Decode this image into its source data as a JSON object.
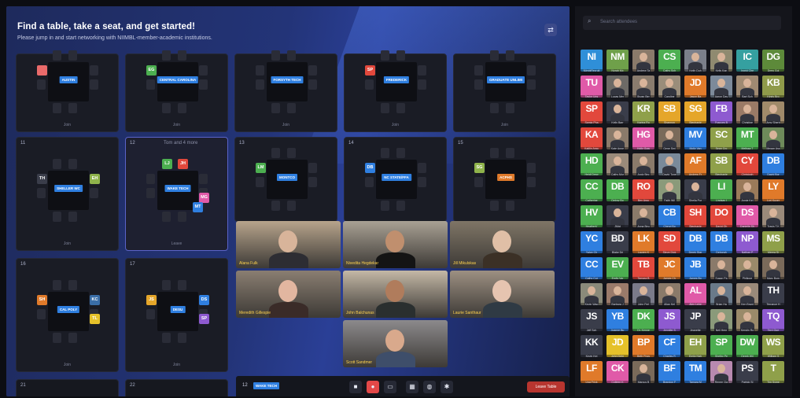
{
  "stage": {
    "title": "Find a table, take a seat, and get started!",
    "subtitle": "Please jump in and start networking with NIIMBL-member-academic institutions.",
    "exit_icon": "exit-icon"
  },
  "tables": [
    {
      "num": "",
      "label": "AUSTIN",
      "avatars": [
        {
          "t": "",
          "c": "#e96a6a"
        }
      ],
      "footer": "Join"
    },
    {
      "num": "",
      "label": "CENTRAL CAROLINA",
      "avatars": [
        {
          "t": "EG",
          "c": "#4caf50"
        }
      ],
      "footer": "Join"
    },
    {
      "num": "",
      "label": "FORSYTH TECH",
      "avatars": [],
      "footer": "Join"
    },
    {
      "num": "",
      "label": "FREDERICK",
      "avatars": [
        {
          "t": "SP",
          "c": "#e2483c"
        }
      ],
      "footer": "Join"
    },
    {
      "num": "",
      "label": "GRADUATE UNLIMI",
      "avatars": [],
      "footer": "Join"
    },
    {
      "num": "11",
      "label": "SHELLER WC",
      "avatars": [
        {
          "t": "TH",
          "c": "#3a3d4a"
        },
        {
          "t": "EH",
          "c": "#8fb34b"
        }
      ],
      "footer": "Join"
    },
    {
      "num": "12",
      "label": "WAKE TECH",
      "avatars": [
        {
          "t": "LJ",
          "c": "#4caf50"
        },
        {
          "t": "JH",
          "c": "#e2483c"
        },
        {
          "t": "MG",
          "c": "#e05aa8"
        },
        {
          "t": "MT",
          "c": "#2f7fe0"
        }
      ],
      "footer": "Leave",
      "note": "Tom and 4 more"
    },
    {
      "num": "13",
      "label": "MONTCO",
      "avatars": [
        {
          "t": "LM",
          "c": "#4caf50"
        }
      ],
      "footer": ""
    },
    {
      "num": "14",
      "label": "NC STATE/FFA",
      "avatars": [
        {
          "t": "DB",
          "c": "#2f7fe0"
        }
      ],
      "footer": ""
    },
    {
      "num": "15",
      "label": "ACPHS",
      "avatars": [
        {
          "t": "SG",
          "c": "#8fb34b"
        }
      ],
      "footer": ""
    },
    {
      "num": "16",
      "label": "CAL POLY",
      "avatars": [
        {
          "t": "SH",
          "c": "#e07a2a"
        },
        {
          "t": "KC",
          "c": "#3a6ea8"
        },
        {
          "t": "TL",
          "c": "#e5c12a"
        }
      ],
      "footer": "Join"
    },
    {
      "num": "17",
      "label": "DESU",
      "avatars": [
        {
          "t": "JS",
          "c": "#e5a62a"
        },
        {
          "t": "DS",
          "c": "#2f7fe0"
        },
        {
          "t": "SP",
          "c": "#8e5ad0"
        }
      ],
      "footer": "Join"
    },
    {
      "num": "21",
      "label": "",
      "avatars": [],
      "footer": ""
    },
    {
      "num": "22",
      "label": "",
      "avatars": [],
      "footer": ""
    }
  ],
  "videos": [
    {
      "name": "Alana Fulk",
      "bg": "#b7a48c"
    },
    {
      "name": "Nivedita Hegdekar",
      "bg": "#a9a194"
    },
    {
      "name": "Jill Mikulskas",
      "bg": "#7f7566"
    },
    {
      "name": "Meredith Gillespie",
      "bg": "#8a7e72"
    },
    {
      "name": "John Balchunas",
      "bg": "#c4b8a6"
    },
    {
      "name": "Laurie Santhaur",
      "bg": "#9d9082"
    },
    {
      "name": "Scott Sandmer",
      "bg": "#8c8a8c"
    }
  ],
  "bottom_bar": {
    "table_num": "12",
    "table_label": "WAKE TECH",
    "leave_label": "Leave Table",
    "controls": [
      "camera-icon",
      "mic-muted-icon",
      "screen-share-icon",
      "grid-icon",
      "chat-icon",
      "settings-icon"
    ]
  },
  "panel": {
    "search_placeholder": "Search attendees",
    "participants": [
      {
        "i": "NI",
        "c": "#2f8fd8",
        "n": "NiimblRecruit"
      },
      {
        "i": "NM",
        "c": "#6fa04a",
        "n": "Norah Mc"
      },
      {
        "i": "",
        "c": "#8a7a6a",
        "n": "Andrew Ta",
        "p": 1
      },
      {
        "i": "CS",
        "c": "#4caf50",
        "n": "Cathy Sch"
      },
      {
        "i": "",
        "c": "#7b7f8a",
        "n": "Keith Duh",
        "p": 1
      },
      {
        "i": "",
        "c": "#8f8a70",
        "n": "Kelly Kan",
        "p": 1
      },
      {
        "i": "IC",
        "c": "#35a0a0",
        "n": "Ingrid Che"
      },
      {
        "i": "DG",
        "c": "#5d8a3a",
        "n": "Drew Gol"
      },
      {
        "i": "TU",
        "c": "#e05aa8",
        "n": "Taylor Ups"
      },
      {
        "i": "",
        "c": "#6d6a66",
        "n": "Lucas Mer",
        "p": 1
      },
      {
        "i": "",
        "c": "#8a7c6e",
        "n": "Bryan Ber",
        "p": 1
      },
      {
        "i": "",
        "c": "#9a8d7a",
        "n": "Caroline",
        "p": 1
      },
      {
        "i": "JD",
        "c": "#e07a2a",
        "n": "Jason Ba"
      },
      {
        "i": "",
        "c": "#7d8a9a",
        "n": "Aaron Day",
        "p": 1
      },
      {
        "i": "",
        "c": "#a08a72",
        "n": "Bart Sch",
        "p": 1
      },
      {
        "i": "KB",
        "c": "#8f9a4a",
        "n": "Kirsty Bro"
      },
      {
        "i": "SP",
        "c": "#e2483c",
        "n": "Samia Pha"
      },
      {
        "i": "",
        "c": "#3a3d4a",
        "n": "Kelly Barr",
        "p": 1
      },
      {
        "i": "KR",
        "c": "#8fa04a",
        "n": "Karina Ro"
      },
      {
        "i": "SB",
        "c": "#e5a62a",
        "n": "Shannon"
      },
      {
        "i": "SG",
        "c": "#e5a62a",
        "n": "Stephanie"
      },
      {
        "i": "FB",
        "c": "#8e5ad0",
        "n": "Frances B"
      },
      {
        "i": "",
        "c": "#9a7a66",
        "n": "Christine",
        "p": 1
      },
      {
        "i": "",
        "c": "#a08a6a",
        "n": "Amy Sherb",
        "p": 1
      },
      {
        "i": "KA",
        "c": "#e2483c",
        "n": "Kaitlin Argo"
      },
      {
        "i": "",
        "c": "#8a7a6a",
        "n": "Kate Anne",
        "p": 1
      },
      {
        "i": "HG",
        "c": "#e05aa8",
        "n": "Holly Gow"
      },
      {
        "i": "",
        "c": "#7a6a5a",
        "n": "Gene Smi",
        "p": 1
      },
      {
        "i": "MV",
        "c": "#2f7fe0",
        "n": "Molly Van"
      },
      {
        "i": "SC",
        "c": "#8fa04a",
        "n": "Sean Cro"
      },
      {
        "i": "MT",
        "c": "#4caf50",
        "n": "Melissa T"
      },
      {
        "i": "",
        "c": "#6e8a5a",
        "n": "Megan Ass",
        "p": 1
      },
      {
        "i": "HD",
        "c": "#4caf50",
        "n": "Heidi Drew"
      },
      {
        "i": "",
        "c": "#9a8a7a",
        "n": "Cathy Mor",
        "p": 1
      },
      {
        "i": "",
        "c": "#8a7a6a",
        "n": "Andy Bec",
        "p": 1
      },
      {
        "i": "",
        "c": "#7a8a9a",
        "n": "David Tone",
        "p": 1
      },
      {
        "i": "AF",
        "c": "#e07a2a",
        "n": "Andrew Fr"
      },
      {
        "i": "SB",
        "c": "#8fa04a",
        "n": "Stephanie"
      },
      {
        "i": "CY",
        "c": "#e2483c",
        "n": "Christoph"
      },
      {
        "i": "DB",
        "c": "#2f7fe0",
        "n": "David Bor"
      },
      {
        "i": "CC",
        "c": "#4caf50",
        "n": "Catherine"
      },
      {
        "i": "DB",
        "c": "#4caf50",
        "n": "Delroy Bo"
      },
      {
        "i": "RO",
        "c": "#e2483c",
        "n": "Bev Argo"
      },
      {
        "i": "",
        "c": "#8a9a7a",
        "n": "Faith Wil",
        "p": 1
      },
      {
        "i": "",
        "c": "#3a3d4a",
        "n": "Sheila Por",
        "p": 1
      },
      {
        "i": "LI",
        "c": "#4caf50",
        "n": "Lindsay I"
      },
      {
        "i": "",
        "c": "#9a7a5a",
        "n": "Annie Kel",
        "p": 1
      },
      {
        "i": "LY",
        "c": "#e07a2a",
        "n": "Lori Kuyer"
      },
      {
        "i": "HV",
        "c": "#4caf50",
        "n": "HeatherV"
      },
      {
        "i": "",
        "c": "#3a3d4a",
        "n": "JMgt",
        "p": 1
      },
      {
        "i": "",
        "c": "#8a7a6a",
        "n": "Anna Beu",
        "p": 1
      },
      {
        "i": "CB",
        "c": "#2f7fe0",
        "n": "Cheryl Bo"
      },
      {
        "i": "SH",
        "c": "#e2483c",
        "n": "Stephanie"
      },
      {
        "i": "DO",
        "c": "#e2483c",
        "n": "David Oh"
      },
      {
        "i": "DS",
        "c": "#e05aa8",
        "n": "Danielle Sh"
      },
      {
        "i": "",
        "c": "#9a8a7a",
        "n": "Travis T.K",
        "p": 1
      },
      {
        "i": "YC",
        "c": "#2f7fe0",
        "n": "Yalun Ch"
      },
      {
        "i": "BD",
        "c": "#3a3d4a",
        "n": "Blake Dri"
      },
      {
        "i": "LK",
        "c": "#e07a2a",
        "n": "Lauren K"
      },
      {
        "i": "SD",
        "c": "#e2483c",
        "n": "Steve Dick"
      },
      {
        "i": "DB",
        "c": "#2f7fe0",
        "n": "Derek Star"
      },
      {
        "i": "DB",
        "c": "#2f7fe0",
        "n": "Deborah"
      },
      {
        "i": "NP",
        "c": "#8e5ad0",
        "n": "Nathan P"
      },
      {
        "i": "MS",
        "c": "#8fa04a",
        "n": "Meera Si"
      },
      {
        "i": "CC",
        "c": "#2f7fe0",
        "n": "Cathy Cur"
      },
      {
        "i": "EV",
        "c": "#4caf50",
        "n": "Emily Var"
      },
      {
        "i": "TB",
        "c": "#e2483c",
        "n": "Tamara B"
      },
      {
        "i": "JC",
        "c": "#e07a2a",
        "n": "James Ch"
      },
      {
        "i": "JB",
        "c": "#2f7fe0",
        "n": "James Bo"
      },
      {
        "i": "",
        "c": "#8a7a6a",
        "n": "Susan Pa",
        "p": 1
      },
      {
        "i": "",
        "c": "#9a8a6a",
        "n": "Philippe",
        "p": 1
      },
      {
        "i": "",
        "c": "#7a6a5a",
        "n": "Marc Bom",
        "p": 1
      },
      {
        "i": "",
        "c": "#8a8a7a",
        "n": "Kevin Wag",
        "p": 1
      },
      {
        "i": "",
        "c": "#9a7a6a",
        "n": "Barbara J",
        "p": 1
      },
      {
        "i": "",
        "c": "#7a7a8a",
        "n": "John Ferl",
        "p": 1
      },
      {
        "i": "",
        "c": "#8a7a6a",
        "n": "Allan Kel",
        "p": 1
      },
      {
        "i": "AL",
        "c": "#e05aa8",
        "n": "Alex Lebe"
      },
      {
        "i": "",
        "c": "#6a7a8a",
        "n": "Brian Ha",
        "p": 1
      },
      {
        "i": "",
        "c": "#9a8a7a",
        "n": "Ken Brant",
        "p": 1
      },
      {
        "i": "TH",
        "c": "#3a3d4a",
        "n": "Terrance H"
      },
      {
        "i": "JS",
        "c": "#3a3d4a",
        "n": "Jeff Sch"
      },
      {
        "i": "YB",
        "c": "#2f7fe0",
        "n": "Joanne Bu"
      },
      {
        "i": "DK",
        "c": "#4caf50",
        "n": "Dr. Kenne"
      },
      {
        "i": "JS",
        "c": "#8e5ad0",
        "n": "Jennifer S"
      },
      {
        "i": "JP",
        "c": "#3a3d4a",
        "n": "Jeanette"
      },
      {
        "i": "",
        "c": "#8a9a7a",
        "n": "Neil Henr",
        "p": 1
      },
      {
        "i": "",
        "c": "#9a8a6a",
        "n": "Kerstin Ro",
        "p": 1
      },
      {
        "i": "TQ",
        "c": "#8e5ad0",
        "n": "Terri Que"
      },
      {
        "i": "KK",
        "c": "#3a3d4a",
        "n": "Kevin Kei"
      },
      {
        "i": "JD",
        "c": "#e5c12a",
        "n": "John Debr"
      },
      {
        "i": "BP",
        "c": "#e07a2a",
        "n": "Beth Poys"
      },
      {
        "i": "CF",
        "c": "#2f7fe0",
        "n": "Charles R"
      },
      {
        "i": "EH",
        "c": "#8fa04a",
        "n": "Emily Hah"
      },
      {
        "i": "SP",
        "c": "#4caf50",
        "n": "Shelby Pe"
      },
      {
        "i": "DW",
        "c": "#4caf50",
        "n": "Derek Wil"
      },
      {
        "i": "WS",
        "c": "#8fa04a",
        "n": "William S"
      },
      {
        "i": "LF",
        "c": "#e07a2a",
        "n": "Lisa Frick"
      },
      {
        "i": "CK",
        "c": "#e05aa8",
        "n": "Colleen K"
      },
      {
        "i": "",
        "c": "#7a6a5a",
        "n": "Marcus B",
        "p": 1
      },
      {
        "i": "BF",
        "c": "#2f7fe0",
        "n": "Brandon F"
      },
      {
        "i": "TM",
        "c": "#2f7fe0",
        "n": "Tamara M"
      },
      {
        "i": "",
        "c": "#b88ab0",
        "n": "Renee Cla",
        "p": 1
      },
      {
        "i": "PS",
        "c": "#3a3d4a",
        "n": "Patrick Sl"
      },
      {
        "i": "T",
        "c": "#8fa04a",
        "n": "Tim Syme"
      }
    ]
  }
}
